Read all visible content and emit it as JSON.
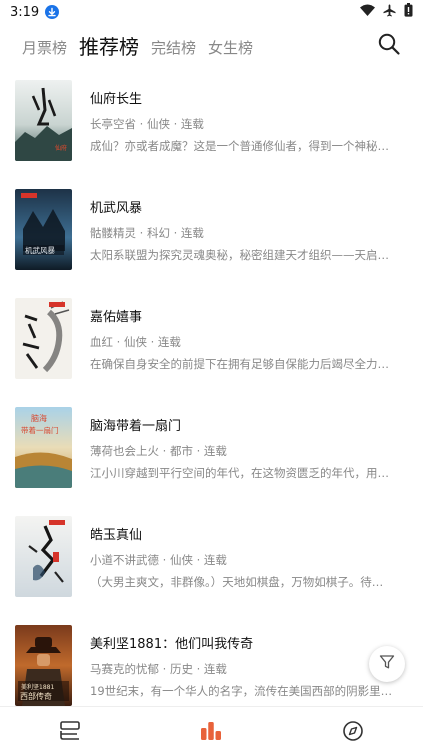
{
  "status_bar": {
    "time": "3:19"
  },
  "tabs": [
    {
      "label": "月票榜",
      "active": false
    },
    {
      "label": "推荐榜",
      "active": true
    },
    {
      "label": "完结榜",
      "active": false
    },
    {
      "label": "女生榜",
      "active": false
    }
  ],
  "books": [
    {
      "title": "仙府长生",
      "meta": "长亭空省 · 仙侠 · 连载",
      "desc": "成仙？亦或者成魔？这是一个普通修仙者，得到一个神秘…",
      "cover_text": "仙府长生"
    },
    {
      "title": "机武风暴",
      "meta": "骷髅精灵 · 科幻 · 连载",
      "desc": "太阳系联盟为探究灵魂奥秘，秘密组建天才组织——天启…",
      "cover_text": "机武风暴"
    },
    {
      "title": "嘉佑嬉事",
      "meta": "血红 · 仙侠 · 连载",
      "desc": "在确保自身安全的前提下在拥有足够自保能力后竭尽全力…",
      "cover_text": "嘉佑嬉事"
    },
    {
      "title": "脑海带着一扇门",
      "meta": "薄荷也会上火 · 都市 · 连载",
      "desc": "江小川穿越到平行空间的年代，在这物资匮乏的年代，用…",
      "cover_text": "脑海带着一扇门"
    },
    {
      "title": "皓玉真仙",
      "meta": "小道不讲武德 · 仙侠 · 连载",
      "desc": "（大男主爽文，非群像。）天地如棋盘，万物如棋子。待…",
      "cover_text": "皓玉真仙"
    },
    {
      "title": "美利坚1881：他们叫我传奇",
      "meta": "马赛克的忧郁 · 历史 · 连载",
      "desc": "19世纪末，有一个华人的名字，流传在美国西部的阴影里…",
      "cover_text": "美利坚1881 西部传奇"
    }
  ],
  "colors": {
    "accent": "#e8623a"
  },
  "icons": {
    "status": [
      "download-icon",
      "wifi-icon",
      "airplane-icon",
      "battery-icon"
    ],
    "header": "search-icon",
    "fab": "filter-icon",
    "nav": [
      "bookshelf-icon",
      "ranking-icon",
      "discover-icon"
    ]
  }
}
